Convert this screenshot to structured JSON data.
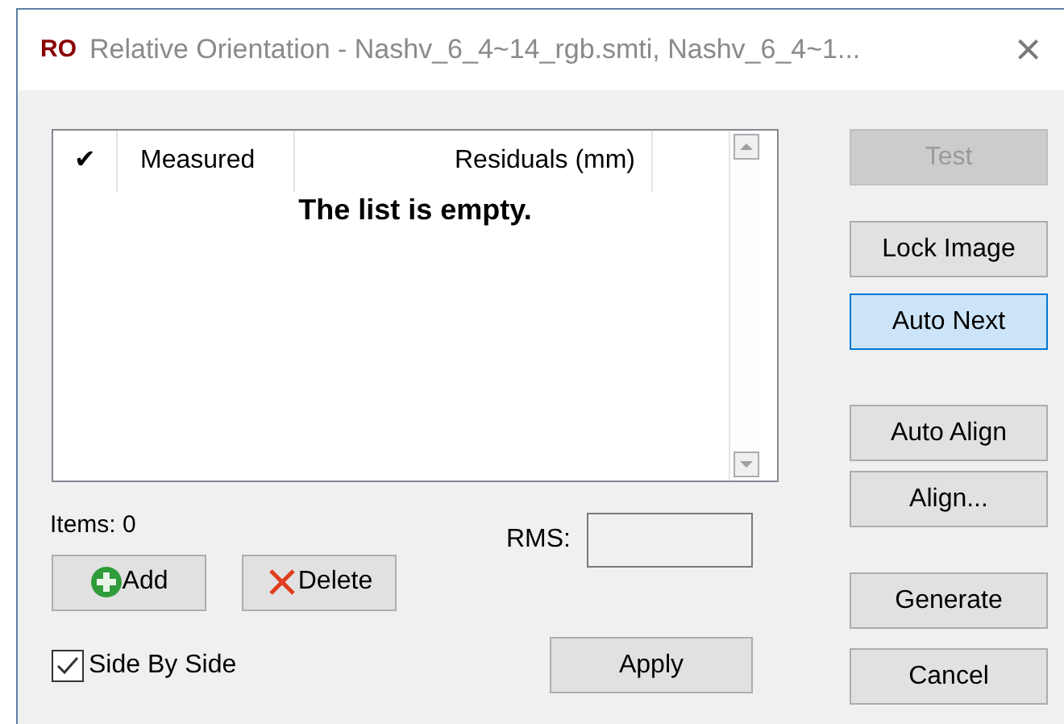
{
  "window": {
    "icon_text": "RO",
    "title": "Relative Orientation - Nashv_6_4~14_rgb.smti, Nashv_6_4~1...",
    "close": "×"
  },
  "list": {
    "columns": [
      "✔",
      "Measured",
      "Residuals (mm)"
    ],
    "empty_text": "The list is empty."
  },
  "items_label": "Items: 0",
  "add_button": "Add",
  "delete_button": "Delete",
  "rms": {
    "label": "RMS:"
  },
  "side_by_side": {
    "label": "Side By Side",
    "checked": true
  },
  "apply_button": "Apply",
  "side_buttons": [
    {
      "label": "Test",
      "disabled": true,
      "focused": false
    },
    {
      "label": "Lock Image",
      "disabled": false,
      "focused": false
    },
    {
      "label": "Auto Next",
      "disabled": false,
      "focused": true
    },
    {
      "label": "Auto Align",
      "disabled": false,
      "focused": false
    },
    {
      "label": "Align...",
      "disabled": false,
      "focused": false
    },
    {
      "label": "Generate",
      "disabled": false,
      "focused": false
    },
    {
      "label": "Cancel",
      "disabled": false,
      "focused": false
    }
  ]
}
